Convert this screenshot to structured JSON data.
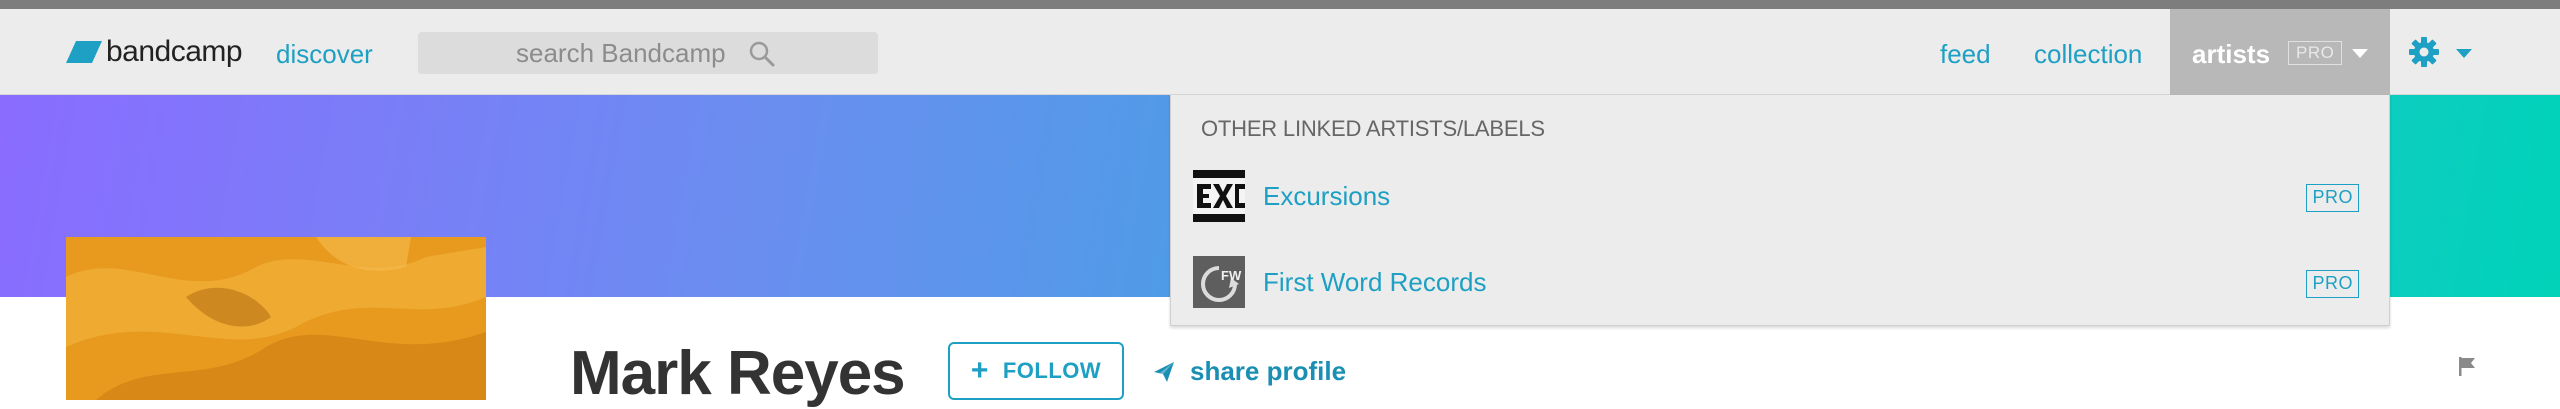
{
  "header": {
    "logo_text": "bandcamp",
    "discover_label": "discover",
    "search_placeholder": "search Bandcamp",
    "feed_label": "feed",
    "collection_label": "collection",
    "artists_label": "artists",
    "pro_badge": "PRO"
  },
  "artist_menu": {
    "heading": "OTHER LINKED ARTISTS/LABELS",
    "items": [
      {
        "name": "Excursions",
        "badge": "PRO"
      },
      {
        "name": "First Word Records",
        "badge": "PRO"
      }
    ]
  },
  "profile": {
    "name": "Mark Reyes",
    "follow_label": "FOLLOW",
    "share_label": "share profile"
  },
  "colors": {
    "accent": "#1da0c3",
    "navbar_bg": "#ececec",
    "artists_tab_bg": "#b8b8b8",
    "banner_start": "#8a6cff",
    "banner_end": "#00d3b8"
  },
  "icons": [
    "bandcamp-logo",
    "search-icon",
    "gear-icon",
    "caret-down-icon",
    "plus-icon",
    "share-icon",
    "flag-icon"
  ]
}
